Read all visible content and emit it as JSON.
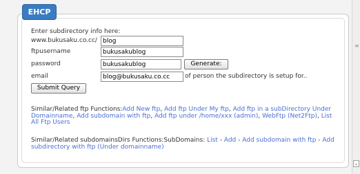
{
  "tab_title": "EHCP",
  "form": {
    "intro": "Enter subdirectory info here:",
    "url_prefix": "www.bukusaku.co.cc/",
    "subdir_value": "blog",
    "ftpusername_label": "ftpusername",
    "ftpusername_value": "bukusakublog",
    "password_label": "password",
    "password_value": "bukusakublog",
    "generate_button": "Generate:",
    "email_label": "email",
    "email_value": "blog@bukusaku.co.cc",
    "email_note": "of person the subdirectory is setup for..",
    "submit_button": "Submit Query"
  },
  "ftp_functions": {
    "label": "Similar/Related ftp Functions:",
    "links": [
      {
        "text": "Add New ftp"
      },
      {
        "text": "Add ftp Under My ftp"
      },
      {
        "text": "Add ftp in a subDirectory Under Domainname"
      },
      {
        "text": "Add subdomain with ftp"
      },
      {
        "text": "Add ftp under /home/xxx (admin)"
      },
      {
        "text": "WebFtp (Net2Ftp)"
      },
      {
        "text": "List All Ftp Users"
      }
    ]
  },
  "subdomain_functions": {
    "label": "Similar/Related subdomainsDirs Functions:SubDomains:",
    "links": [
      {
        "text": "List"
      },
      {
        "text": "Add"
      },
      {
        "text": "Add subdomain with ftp"
      },
      {
        "text": "Add subdirectory with ftp (Under domainname)"
      }
    ]
  },
  "colors": {
    "tab": "#3a7cc2",
    "link": "#4a6fd0"
  }
}
